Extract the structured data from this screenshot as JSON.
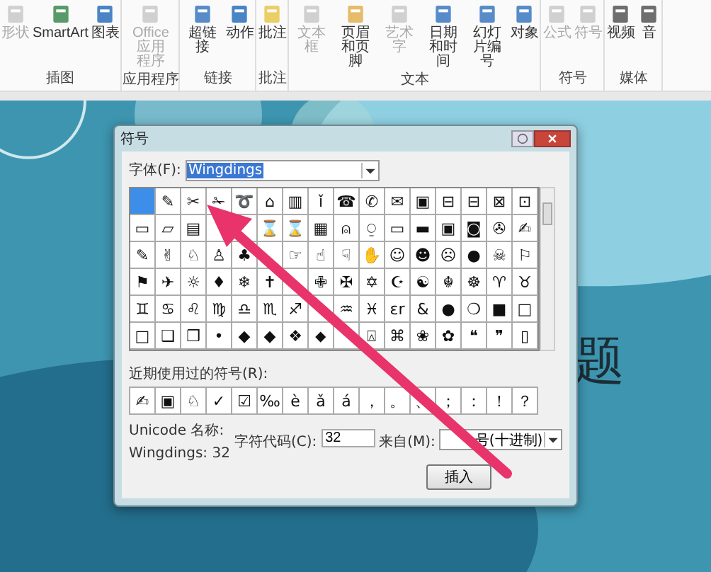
{
  "ribbon": {
    "groups": [
      {
        "label": "插图",
        "items": [
          {
            "label": "形状",
            "disabled": true
          },
          {
            "label": "SmartArt",
            "disabled": false
          },
          {
            "label": "图表",
            "disabled": false
          }
        ]
      },
      {
        "label": "应用程序",
        "items": [
          {
            "label": "Office 应用程序",
            "disabled": true
          }
        ]
      },
      {
        "label": "链接",
        "items": [
          {
            "label": "超链接",
            "disabled": false
          },
          {
            "label": "动作",
            "disabled": false
          }
        ]
      },
      {
        "label": "批注",
        "items": [
          {
            "label": "批注",
            "disabled": false
          }
        ]
      },
      {
        "label": "文本",
        "items": [
          {
            "label": "文本框",
            "disabled": true
          },
          {
            "label": "页眉和页脚",
            "disabled": false
          },
          {
            "label": "艺术字",
            "disabled": true
          },
          {
            "label": "日期和时间",
            "disabled": false
          },
          {
            "label": "幻灯片编号",
            "disabled": false
          },
          {
            "label": "对象",
            "disabled": false
          }
        ]
      },
      {
        "label": "符号",
        "items": [
          {
            "label": "公式",
            "disabled": true
          },
          {
            "label": "符号",
            "disabled": true
          }
        ]
      },
      {
        "label": "媒体",
        "items": [
          {
            "label": "视频",
            "disabled": false
          },
          {
            "label": "音",
            "disabled": false
          }
        ]
      }
    ]
  },
  "slide": {
    "title": "题"
  },
  "dialog": {
    "title": "符号",
    "font": {
      "label": "字体(F):",
      "value": "Wingdings"
    },
    "symbols": [
      {
        "selected": true
      },
      {
        "symbol": "✎",
        "selected": false
      },
      {
        "symbol": "✂",
        "selected": false
      },
      {
        "symbol": "✁",
        "selected": false
      },
      {
        "symbol": "➰",
        "selected": false
      },
      {
        "symbol": "⌂",
        "selected": false
      },
      {
        "symbol": "▥",
        "selected": false
      },
      {
        "symbol": "ǐ",
        "selected": false
      },
      {
        "symbol": "☎",
        "selected": false
      },
      {
        "symbol": "✆",
        "selected": false
      },
      {
        "symbol": "✉",
        "selected": false
      },
      {
        "symbol": "▣",
        "selected": false
      },
      {
        "symbol": "⊟",
        "selected": false
      },
      {
        "symbol": "⊟",
        "selected": false
      },
      {
        "symbol": "⊠",
        "selected": false
      },
      {
        "symbol": "⊡",
        "selected": false
      },
      {
        "symbol": "▭",
        "selected": false
      },
      {
        "symbol": "▱",
        "selected": false
      },
      {
        "symbol": "▤",
        "selected": false
      },
      {
        "selected": false
      },
      {
        "selected": false
      },
      {
        "symbol": "⌛",
        "selected": false
      },
      {
        "symbol": "⌛",
        "selected": false
      },
      {
        "symbol": "▦",
        "selected": false
      },
      {
        "symbol": "⍝",
        "selected": false
      },
      {
        "symbol": "⍜",
        "selected": false
      },
      {
        "symbol": "▭",
        "selected": false
      },
      {
        "symbol": "▬",
        "selected": false
      },
      {
        "symbol": "▣",
        "selected": false
      },
      {
        "symbol": "◙",
        "selected": false
      },
      {
        "symbol": "✇",
        "selected": false
      },
      {
        "symbol": "✍",
        "selected": false
      },
      {
        "symbol": "✎",
        "selected": false
      },
      {
        "symbol": "✌",
        "selected": false
      },
      {
        "symbol": "♘",
        "selected": false
      },
      {
        "symbol": "♙",
        "selected": false
      },
      {
        "symbol": "♣",
        "selected": false
      },
      {
        "selected": false
      },
      {
        "symbol": "☞",
        "selected": false
      },
      {
        "symbol": "☝",
        "selected": false
      },
      {
        "symbol": "☟",
        "selected": false
      },
      {
        "symbol": "✋",
        "selected": false
      },
      {
        "symbol": "☺",
        "selected": false
      },
      {
        "symbol": "☻",
        "selected": false
      },
      {
        "symbol": "☹",
        "selected": false
      },
      {
        "symbol": "●",
        "selected": false
      },
      {
        "symbol": "☠",
        "selected": false
      },
      {
        "symbol": "⚐",
        "selected": false
      },
      {
        "symbol": "⚑",
        "selected": false
      },
      {
        "symbol": "✈",
        "selected": false
      },
      {
        "symbol": "☼",
        "selected": false
      },
      {
        "symbol": "♦",
        "selected": false
      },
      {
        "symbol": "❄",
        "selected": false
      },
      {
        "symbol": "✝",
        "selected": false
      },
      {
        "selected": false
      },
      {
        "symbol": "✙",
        "selected": false
      },
      {
        "symbol": "✠",
        "selected": false
      },
      {
        "symbol": "✡",
        "selected": false
      },
      {
        "symbol": "☪",
        "selected": false
      },
      {
        "symbol": "☯",
        "selected": false
      },
      {
        "symbol": "☬",
        "selected": false
      },
      {
        "symbol": "☸",
        "selected": false
      },
      {
        "symbol": "♈",
        "selected": false
      },
      {
        "symbol": "♉",
        "selected": false
      },
      {
        "symbol": "♊",
        "selected": false
      },
      {
        "symbol": "♋",
        "selected": false
      },
      {
        "symbol": "♌",
        "selected": false
      },
      {
        "symbol": "♍",
        "selected": false
      },
      {
        "symbol": "♎",
        "selected": false
      },
      {
        "symbol": "♏",
        "selected": false
      },
      {
        "symbol": "♐",
        "selected": false
      },
      {
        "selected": false
      },
      {
        "symbol": "♒",
        "selected": false
      },
      {
        "symbol": "♓",
        "selected": false
      },
      {
        "symbol": "ɛr",
        "selected": false
      },
      {
        "symbol": "&",
        "selected": false
      },
      {
        "symbol": "●",
        "selected": false
      },
      {
        "symbol": "❍",
        "selected": false
      },
      {
        "symbol": "■",
        "selected": false
      },
      {
        "symbol": "□",
        "selected": false
      },
      {
        "symbol": "□",
        "selected": false
      },
      {
        "symbol": "❑",
        "selected": false
      },
      {
        "symbol": "❒",
        "selected": false
      },
      {
        "symbol": "•",
        "selected": false
      },
      {
        "symbol": "◆",
        "selected": false
      },
      {
        "symbol": "◆",
        "selected": false
      },
      {
        "symbol": "❖",
        "selected": false
      },
      {
        "symbol": "⬥",
        "selected": false
      },
      {
        "selected": false
      },
      {
        "symbol": "⍓",
        "selected": false
      },
      {
        "symbol": "⌘",
        "selected": false
      },
      {
        "symbol": "❀",
        "selected": false
      },
      {
        "symbol": "✿",
        "selected": false
      },
      {
        "symbol": "❝",
        "selected": false
      },
      {
        "symbol": "❞",
        "selected": false
      },
      {
        "symbol": "▯",
        "selected": false
      }
    ],
    "recent_label": "近期使用过的符号(R):",
    "recent": [
      "✍",
      "▣",
      "♘",
      "✓",
      "☑",
      "‰",
      "è",
      "ǎ",
      "á",
      "，",
      "。",
      "、",
      "；",
      "：",
      "！",
      "？"
    ],
    "unicode_name_label": "Unicode 名称:",
    "unicode_name": "Wingdings: 32",
    "char_code": {
      "label": "字符代码(C):",
      "value": "32"
    },
    "from": {
      "label": "来自(M):",
      "value": "号(十进制)"
    },
    "buttons": [
      "插入"
    ]
  }
}
